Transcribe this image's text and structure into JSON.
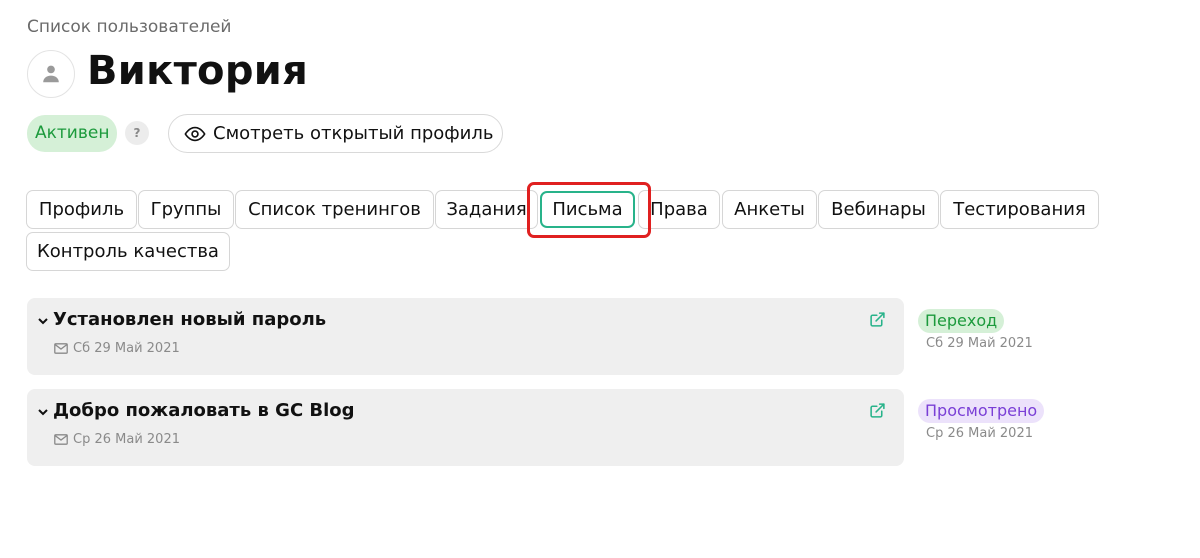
{
  "breadcrumb": "Список пользователей",
  "user": {
    "name": "Виктория",
    "status": "Активен",
    "help": "?",
    "view_profile_label": "Смотреть открытый профиль"
  },
  "tabs": [
    {
      "label": "Профиль"
    },
    {
      "label": "Группы"
    },
    {
      "label": "Список тренингов"
    },
    {
      "label": "Задания"
    },
    {
      "label": "Письма",
      "active": true
    },
    {
      "label": "Права"
    },
    {
      "label": "Анкеты"
    },
    {
      "label": "Вебинары"
    },
    {
      "label": "Тестирования"
    },
    {
      "label": "Контроль качества"
    }
  ],
  "messages": [
    {
      "title": "Установлен новый пароль",
      "date": "Сб 29 Май 2021",
      "event": {
        "label": "Переход",
        "date": "Сб 29 Май 2021",
        "bg": "#d5f0d7",
        "fg": "#1c9a3c"
      }
    },
    {
      "title": "Добро пожаловать в GC Blog",
      "date": "Ср 26 Май 2021",
      "event": {
        "label": "Просмотрено",
        "date": "Ср 26 Май 2021",
        "bg": "#ece2fb",
        "fg": "#7a3fd6"
      }
    }
  ],
  "colors": {
    "accent": "#28b38a",
    "highlight": "#e02020",
    "card_bg": "#efefef"
  },
  "icons": {
    "avatar": "person-icon",
    "view_profile": "eye-icon",
    "message_toggle": "chevron-down-icon",
    "message_date": "mail-icon",
    "message_open": "external-link-icon"
  }
}
